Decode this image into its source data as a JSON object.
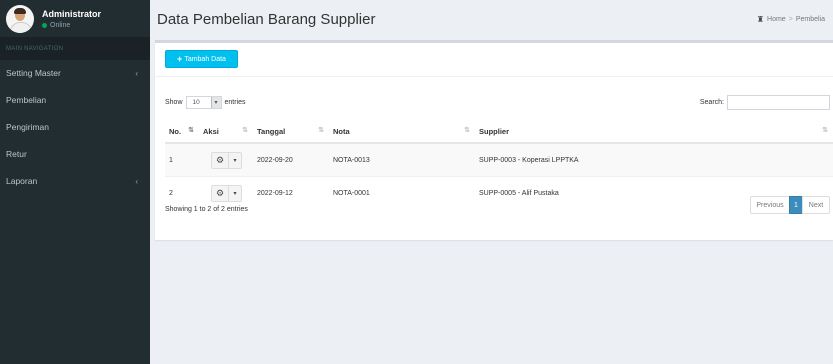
{
  "sidebar": {
    "user_name": "Administrator",
    "user_status": "Online",
    "nav_header": "MAIN NAVIGATION",
    "items": [
      {
        "label": "Setting Master",
        "has_children": true
      },
      {
        "label": "Pembelian",
        "has_children": false
      },
      {
        "label": "Pengiriman",
        "has_children": false
      },
      {
        "label": "Retur",
        "has_children": false
      },
      {
        "label": "Laporan",
        "has_children": true
      }
    ]
  },
  "header": {
    "title": "Data Pembelian Barang Supplier",
    "breadcrumb": [
      "Home",
      "Pembelia"
    ]
  },
  "toolbar": {
    "add_label": "Tambah Data"
  },
  "table_controls": {
    "show_label": "Show",
    "entries_value": "10",
    "entries_label": "entries",
    "search_label": "Search:"
  },
  "table": {
    "columns": [
      "No.",
      "Aksi",
      "Tanggal",
      "Nota",
      "Supplier"
    ],
    "rows": [
      {
        "no": "1",
        "tanggal": "2022-09-20",
        "nota": "NOTA-0013",
        "supplier": "SUPP-0003 - Koperasi LPPTKA"
      },
      {
        "no": "2",
        "tanggal": "2022-09-12",
        "nota": "NOTA-0001",
        "supplier": "SUPP-0005 - Alif Pustaka"
      }
    ]
  },
  "footer": {
    "info": "Showing 1 to 2 of 2 entries",
    "prev_label": "Previous",
    "page": "1",
    "next_label": "Next"
  },
  "colors": {
    "sidebar_bg": "#222d32",
    "accent": "#00c0ef",
    "page_active": "#3c8dbc",
    "online": "#00a65a"
  }
}
